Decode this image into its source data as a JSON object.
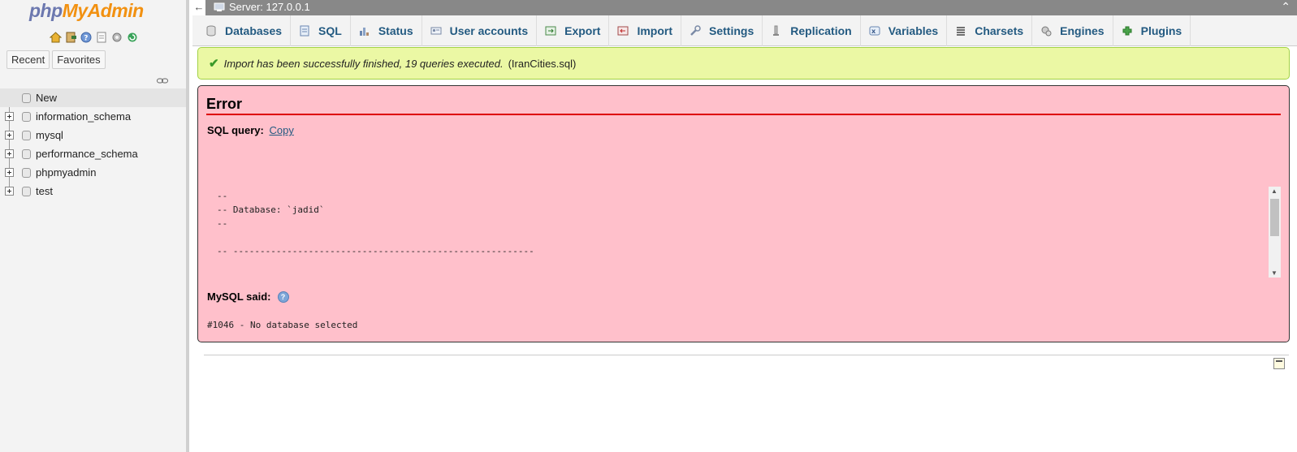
{
  "logo": {
    "part1": "php",
    "part2": "MyAdmin"
  },
  "nav_tabs": {
    "recent": "Recent",
    "favorites": "Favorites"
  },
  "tree": [
    {
      "label": "New"
    },
    {
      "label": "information_schema"
    },
    {
      "label": "mysql"
    },
    {
      "label": "performance_schema"
    },
    {
      "label": "phpmyadmin"
    },
    {
      "label": "test"
    }
  ],
  "topbar": {
    "server": "Server: 127.0.0.1"
  },
  "tabs": [
    {
      "label": "Databases",
      "icon": "database-icon"
    },
    {
      "label": "SQL",
      "icon": "sql-icon"
    },
    {
      "label": "Status",
      "icon": "status-icon"
    },
    {
      "label": "User accounts",
      "icon": "users-icon"
    },
    {
      "label": "Export",
      "icon": "export-icon"
    },
    {
      "label": "Import",
      "icon": "import-icon"
    },
    {
      "label": "Settings",
      "icon": "wrench-icon"
    },
    {
      "label": "Replication",
      "icon": "replication-icon"
    },
    {
      "label": "Variables",
      "icon": "variables-icon"
    },
    {
      "label": "Charsets",
      "icon": "charsets-icon"
    },
    {
      "label": "Engines",
      "icon": "engines-icon"
    },
    {
      "label": "Plugins",
      "icon": "plugins-icon"
    }
  ],
  "success": {
    "message": "Import has been successfully finished, 19 queries executed.",
    "file": "(IranCities.sql)"
  },
  "error": {
    "title": "Error",
    "sql_query_label": "SQL query:",
    "copy_link": "Copy",
    "sql_lines": [
      "--",
      "-- Database: `jadid`",
      "--",
      "",
      "-- --------------------------------------------------------"
    ],
    "mysql_said_label": "MySQL said:",
    "message": "#1046 - No database selected"
  },
  "colors": {
    "accent": "#235a81",
    "success_bg": "#ebf8a4",
    "error_bg": "#ffc0cb",
    "logo_php": "#6c78af",
    "logo_myadmin": "#f29111"
  }
}
